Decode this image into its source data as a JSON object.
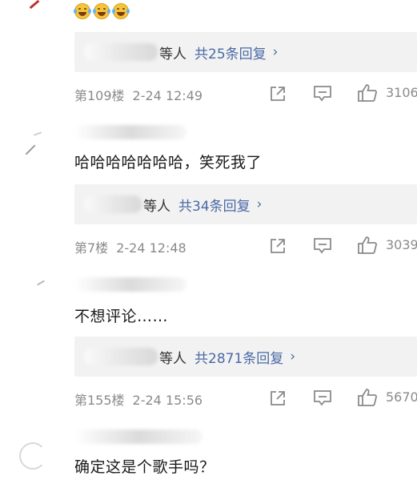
{
  "comments": [
    {
      "emoji_names": [
        "laugh-cry-emoji",
        "laugh-cry-emoji",
        "laugh-cry-emoji"
      ],
      "reply": {
        "people_suffix": "等人",
        "count_label": "共25条回复",
        "chevron": "›"
      },
      "meta": {
        "floor": "第109楼",
        "time": "2-24 12:49",
        "likes": "3106"
      }
    },
    {
      "text": "哈哈哈哈哈哈哈，笑死我了",
      "reply": {
        "people_suffix": "等人",
        "count_label": "共34条回复",
        "chevron": "›"
      },
      "meta": {
        "floor": "第7楼",
        "time": "2-24 12:48",
        "likes": "3039"
      }
    },
    {
      "text": "不想评论……",
      "reply": {
        "people_suffix": "等人",
        "count_label": "共2871条回复",
        "chevron": "›"
      },
      "meta": {
        "floor": "第155楼",
        "time": "2-24 15:56",
        "likes": "5670"
      }
    },
    {
      "text": "确定这是个歌手吗？"
    }
  ],
  "icons": {
    "share": "share-icon",
    "comment": "comment-icon",
    "like": "thumbs-up-icon"
  },
  "colors": {
    "link": "#4a6aa5",
    "meta": "#8a8a8a",
    "reply_bg": "#f2f2f2"
  }
}
